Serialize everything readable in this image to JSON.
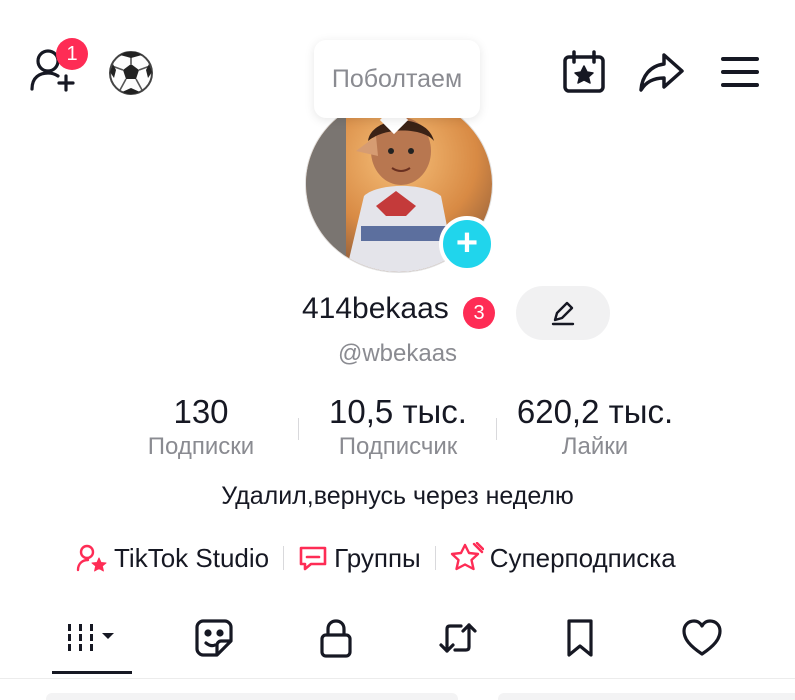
{
  "header": {
    "notification_count": "1",
    "bubble_text": "Поболтаем"
  },
  "profile": {
    "username": "414bekaas",
    "username_badge": "3",
    "handle": "@wbekaas",
    "bio": "Удалил,вернусь через неделю"
  },
  "stats": [
    {
      "value": "130",
      "label": "Подписки"
    },
    {
      "value": "10,5 тыс.",
      "label": "Подписчик"
    },
    {
      "value": "620,2 тыс.",
      "label": "Лайки"
    }
  ],
  "links": [
    {
      "label": "TikTok Studio",
      "icon": "person-star-icon"
    },
    {
      "label": "Группы",
      "icon": "chat-bubble-icon"
    },
    {
      "label": "Суперподписка",
      "icon": "star-badge-icon"
    }
  ],
  "tabs": [
    {
      "name": "videos",
      "icon": "grid-bars-icon",
      "active": true
    },
    {
      "name": "stickers",
      "icon": "sticker-icon"
    },
    {
      "name": "private",
      "icon": "lock-icon"
    },
    {
      "name": "reposts",
      "icon": "repost-icon"
    },
    {
      "name": "saved",
      "icon": "bookmark-icon"
    },
    {
      "name": "liked",
      "icon": "heart-icon"
    }
  ],
  "colors": {
    "accent_red": "#fe2c55",
    "accent_cyan": "#20d5ec",
    "text_primary": "#161823",
    "text_secondary": "#8a8b91"
  }
}
